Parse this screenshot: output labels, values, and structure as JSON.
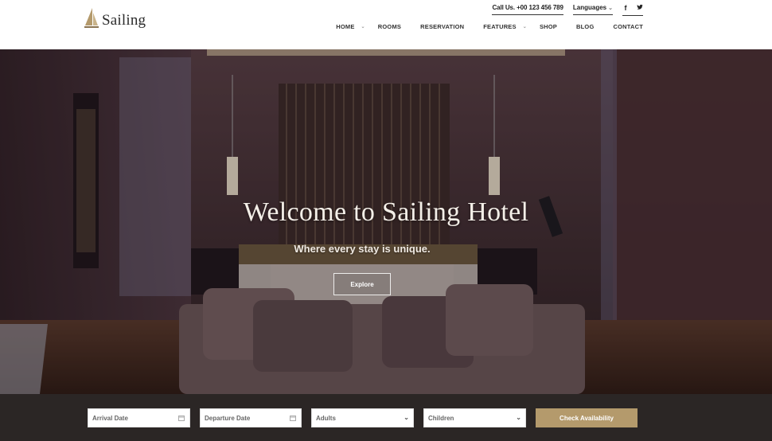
{
  "brand": {
    "name": "Sailing",
    "accent": "#b49a6c"
  },
  "topbar": {
    "phone": "Call Us. +00 123 456 789",
    "languages": "Languages",
    "social": [
      "f",
      "t"
    ]
  },
  "nav": {
    "items": [
      {
        "label": "HOME",
        "has_dropdown": true
      },
      {
        "label": "ROOMS",
        "has_dropdown": false
      },
      {
        "label": "RESERVATION",
        "has_dropdown": false
      },
      {
        "label": "FEATURES",
        "has_dropdown": true
      },
      {
        "label": "SHOP",
        "has_dropdown": false
      },
      {
        "label": "BLOG",
        "has_dropdown": false
      },
      {
        "label": "CONTACT",
        "has_dropdown": false
      }
    ]
  },
  "hero": {
    "title": "Welcome to Sailing Hotel",
    "subtitle": "Where every stay is unique.",
    "cta": "Explore"
  },
  "booking": {
    "arrival_placeholder": "Arrival Date",
    "departure_placeholder": "Departure Date",
    "adults_placeholder": "Adults",
    "children_placeholder": "Children",
    "submit": "Check Availability",
    "icons": [
      "calendar-icon",
      "calendar-icon",
      "chevron-down-icon",
      "chevron-down-icon"
    ]
  }
}
